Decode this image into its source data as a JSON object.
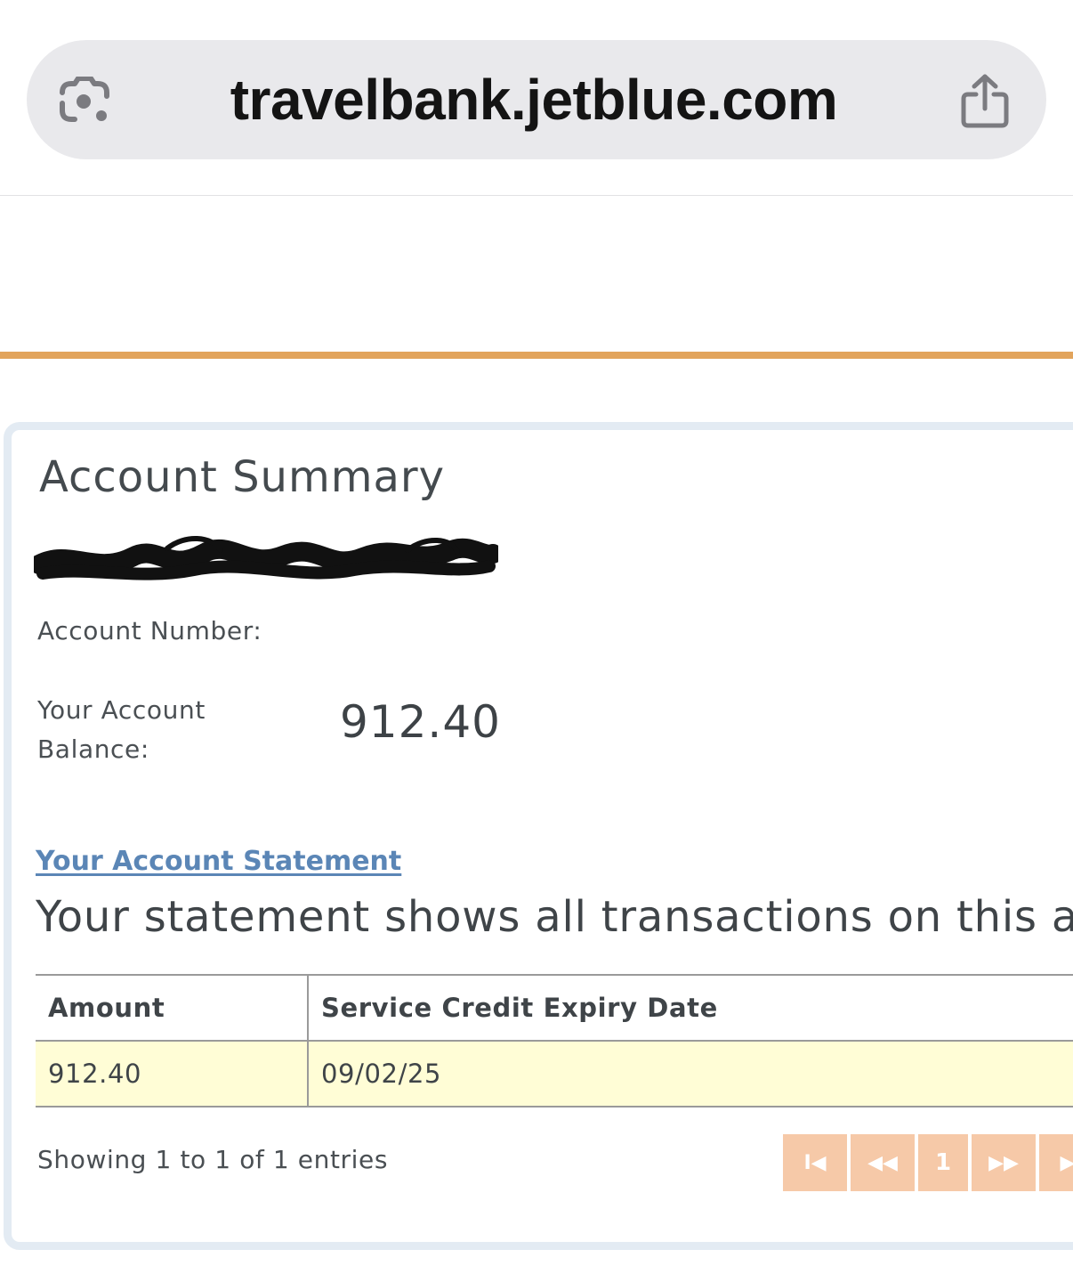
{
  "browser": {
    "url": "travelbank.jetblue.com",
    "lens_icon": "camera-lens-icon",
    "share_icon": "share-icon"
  },
  "colors": {
    "accent_rule": "#e2a45c",
    "link": "#5b86b6",
    "row_highlight": "#fffdd6",
    "pager_button": "#f6c9a8",
    "panel_border": "#e3ebf3"
  },
  "account": {
    "title": "Account Summary",
    "account_number_label": "Account Number:",
    "balance_label": "Your Account Balance:",
    "balance_value": "912.40"
  },
  "statement": {
    "link_text": "Your Account Statement",
    "description": "Your statement shows all transactions on this a"
  },
  "table": {
    "headers": [
      "Amount",
      "Service Credit Expiry Date"
    ],
    "rows": [
      [
        "912.40",
        "09/02/25"
      ]
    ]
  },
  "footer": {
    "entries_info": "Showing 1 to 1 of 1 entries"
  },
  "pager": {
    "first_label": "I◀",
    "prev_label": "◀◀",
    "current_page": "1",
    "next_label": "▶▶",
    "last_label": "▶I"
  }
}
